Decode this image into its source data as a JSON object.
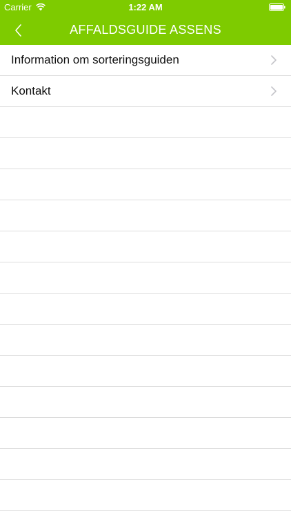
{
  "status_bar": {
    "carrier": "Carrier",
    "time": "1:22 AM",
    "wifi_icon": "wifi-icon",
    "battery_icon": "battery-icon"
  },
  "nav": {
    "back_icon": "chevron-left-icon",
    "title": "AFFALDSGUIDE ASSENS",
    "color": "#7ecb00"
  },
  "list": {
    "items": [
      {
        "label": "Information om sorteringsguiden",
        "icon": "chevron-right-icon"
      },
      {
        "label": "Kontakt",
        "icon": "chevron-right-icon"
      }
    ]
  }
}
